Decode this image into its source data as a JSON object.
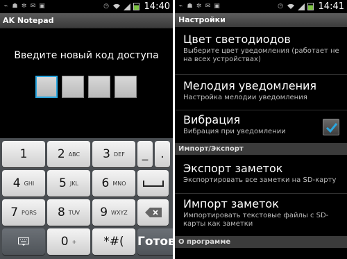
{
  "left": {
    "time": "14:40",
    "app_title": "AK Notepad",
    "prompt": "Введите новый код доступа",
    "keys": [
      [
        {
          "num": "1",
          "let": ""
        },
        {
          "num": "2",
          "let": "ABC"
        },
        {
          "num": "3",
          "let": "DEF"
        },
        {
          "num": "_",
          "let": ""
        },
        {
          "num": ".",
          "let": ""
        }
      ],
      [
        {
          "num": "4",
          "let": "GHI"
        },
        {
          "num": "5",
          "let": "JKL"
        },
        {
          "num": "6",
          "let": "MNO"
        },
        {
          "num": "space",
          "let": ""
        }
      ],
      [
        {
          "num": "7",
          "let": "PQRS"
        },
        {
          "num": "8",
          "let": "TUV"
        },
        {
          "num": "9",
          "let": "WXYZ"
        },
        {
          "num": "backspace",
          "let": ""
        }
      ],
      [
        {
          "num": "kbd",
          "let": ""
        },
        {
          "num": "0",
          "let": "+"
        },
        {
          "num": "*#(",
          "let": ""
        },
        {
          "num": "Готово",
          "let": ""
        }
      ]
    ]
  },
  "right": {
    "time": "14:41",
    "title": "Настройки",
    "prefs": [
      {
        "title": "Цвет светодиодов",
        "summary": "Выберите цвет уведомления (работает не на всех устройствах)"
      },
      {
        "title": "Мелодия уведомления",
        "summary": "Настройка мелодии уведомления"
      },
      {
        "title": "Вибрация",
        "summary": "Вибрация при уведомлении"
      },
      {
        "title": "Экспорт заметок",
        "summary": "Экспортировать все заметки на SD-карту"
      },
      {
        "title": "Импорт заметок",
        "summary": "Импортировать текстовые файлы с SD-карты как заметки"
      }
    ],
    "sections": {
      "import_export": "Импорт/Экспорт",
      "about": "О программе"
    }
  },
  "colors": {
    "accent": "#2aa7e0",
    "battery": "#7cc242"
  }
}
